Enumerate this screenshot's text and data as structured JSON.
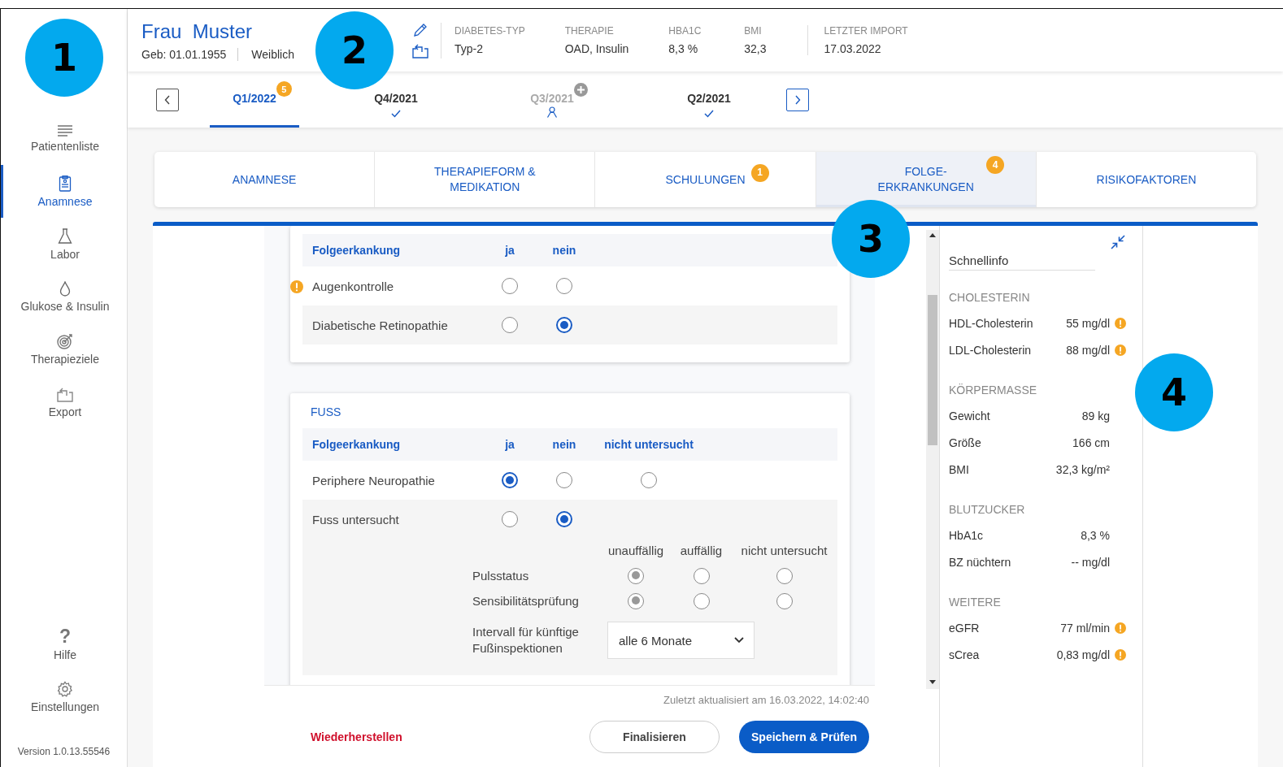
{
  "sidebar": {
    "items": [
      {
        "label": "Patientenliste",
        "selected": false
      },
      {
        "label": "Anamnese",
        "selected": true
      },
      {
        "label": "Labor",
        "selected": false
      },
      {
        "label": "Glukose & Insulin",
        "selected": false
      },
      {
        "label": "Therapieziele",
        "selected": false
      },
      {
        "label": "Export",
        "selected": false
      }
    ],
    "footer_items": [
      {
        "label": "Hilfe",
        "glyph": "?"
      },
      {
        "label": "Einstellungen"
      }
    ],
    "version": "Version 1.0.13.55546"
  },
  "header": {
    "name": "Frau  Muster",
    "birth": "Geb: 01.01.1955",
    "gender": "Weiblich",
    "stats": [
      {
        "label": "DIABETES-TYP",
        "value": "Typ-2"
      },
      {
        "label": "THERAPIE",
        "value": "OAD, Insulin"
      },
      {
        "label": "HBA1C",
        "value": "8,3 %"
      },
      {
        "label": "BMI",
        "value": "32,3"
      }
    ],
    "import": {
      "label": "LETZTER IMPORT",
      "value": "17.03.2022"
    }
  },
  "quarters": [
    {
      "label": "Q1/2022",
      "selected": true,
      "disabled": false,
      "badge": "5",
      "done": false,
      "assigned": false,
      "add": false
    },
    {
      "label": "Q4/2021",
      "selected": false,
      "disabled": false,
      "done": true,
      "assigned": false,
      "add": false
    },
    {
      "label": "Q3/2021",
      "selected": false,
      "disabled": true,
      "done": false,
      "assigned": true,
      "add": true
    },
    {
      "label": "Q2/2021",
      "selected": false,
      "disabled": false,
      "done": true,
      "assigned": false,
      "add": false
    }
  ],
  "tabs": [
    {
      "label": "ANAMNESE",
      "selected": false
    },
    {
      "label": "THERAPIEFORM & MEDIKATION",
      "selected": false
    },
    {
      "label": "SCHULUNGEN",
      "selected": false,
      "badge": "1"
    },
    {
      "label": "FOLGE-ERKRANKUNGEN",
      "selected": true,
      "badge": "4"
    },
    {
      "label": "RISIKOFAKTOREN",
      "selected": false
    }
  ],
  "sections": [
    {
      "columns": [
        "Folgeerkankung",
        "ja",
        "nein"
      ],
      "rows": [
        {
          "label": "Augenkontrolle",
          "warning": true,
          "options": [
            {
              "selected": false
            },
            {
              "selected": false
            }
          ]
        },
        {
          "label": "Diabetische Retinopathie",
          "warning": false,
          "options": [
            {
              "selected": false
            },
            {
              "selected": true
            }
          ]
        }
      ]
    },
    {
      "title": "FUSS",
      "columns": [
        "Folgeerkankung",
        "ja",
        "nein",
        "nicht untersucht"
      ],
      "rows": [
        {
          "label": "Periphere Neuropathie",
          "warning": false,
          "options": [
            {
              "selected": true
            },
            {
              "selected": false
            },
            {
              "selected": false
            }
          ]
        },
        {
          "label": "Fuss untersucht",
          "warning": false,
          "options": [
            {
              "selected": false
            },
            {
              "selected": true
            }
          ],
          "details": {
            "disabled": true,
            "columns": [
              "unauffällig",
              "auffällig",
              "nicht untersucht"
            ],
            "rows": [
              {
                "label": "Pulsstatus",
                "options": [
                  {
                    "selected": true
                  },
                  {
                    "selected": false
                  },
                  {
                    "selected": false
                  }
                ]
              },
              {
                "label": "Sensibilitätsprüfung",
                "options": [
                  {
                    "selected": true
                  },
                  {
                    "selected": false
                  },
                  {
                    "selected": false
                  }
                ]
              }
            ],
            "interval": {
              "label": "Intervall für künftige Fußinspektionen",
              "value": "alle 6 Monate"
            }
          }
        }
      ]
    }
  ],
  "footer": {
    "updated": "Zuletzt aktualisiert am 16.03.2022, 14:02:40",
    "restore": "Wiederherstellen",
    "finalize": "Finalisieren",
    "save": "Speichern & Prüfen"
  },
  "quickinfo": {
    "title": "Schnellinfo",
    "groups": [
      {
        "title": "CHOLESTERIN",
        "items": [
          {
            "label": "HDL-Cholesterin",
            "value": "55 mg/dl",
            "warning": true
          },
          {
            "label": "LDL-Cholesterin",
            "value": "88 mg/dl",
            "warning": true
          }
        ]
      },
      {
        "title": "KÖRPERMASSE",
        "items": [
          {
            "label": "Gewicht",
            "value": "89 kg",
            "warning": false
          },
          {
            "label": "Größe",
            "value": "166 cm",
            "warning": false
          },
          {
            "label": "BMI",
            "value": "32,3 kg/m²",
            "warning": false
          }
        ]
      },
      {
        "title": "BLUTZUCKER",
        "items": [
          {
            "label": "HbA1c",
            "value": "8,3 %",
            "warning": false
          },
          {
            "label": "BZ nüchtern",
            "value": "-- mg/dl",
            "warning": false
          }
        ]
      },
      {
        "title": "WEITERE",
        "items": [
          {
            "label": "eGFR",
            "value": "77 ml/min",
            "warning": true
          },
          {
            "label": "sCrea",
            "value": "0,83 mg/dl",
            "warning": true
          }
        ]
      }
    ]
  },
  "callouts": [
    "1",
    "2",
    "3",
    "4"
  ]
}
